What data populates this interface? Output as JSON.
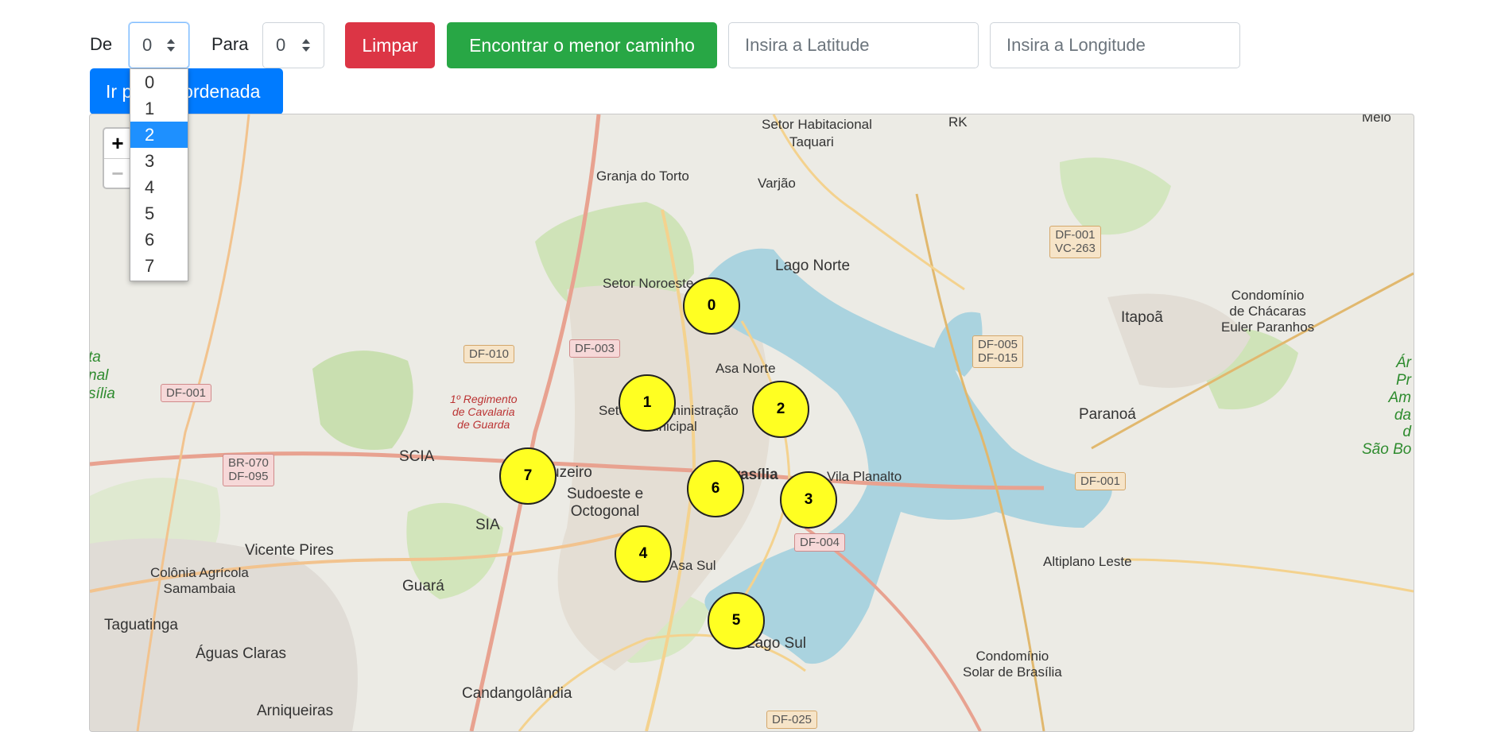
{
  "controls": {
    "from_label": "De",
    "from_value": "0",
    "to_label": "Para",
    "to_value": "0",
    "clear_button": "Limpar",
    "shortest_path_button": "Encontrar o menor caminho",
    "latitude_placeholder": "Insira a Latitude",
    "longitude_placeholder": "Insira a Longitude",
    "goto_button": "Ir para coordenada"
  },
  "dropdown": {
    "options": [
      "0",
      "1",
      "2",
      "3",
      "4",
      "5",
      "6",
      "7"
    ],
    "highlighted": "2"
  },
  "map": {
    "zoom_in": "+",
    "zoom_out": "−",
    "markers": [
      "0",
      "1",
      "2",
      "3",
      "4",
      "5",
      "6",
      "7"
    ],
    "places": {
      "setor_habitacional": "Setor Habitacional",
      "taquari": "Taquari",
      "rk": "RK",
      "melo": "Melo",
      "granja": "Granja do Torto",
      "varjao": "Varjão",
      "lago_norte": "Lago Norte",
      "setor_noroeste": "Setor Noroeste",
      "itapoa": "Itapoã",
      "condominio_chacaras": "Condomínio\nde Chácaras\nEuler Paranhos",
      "asa_norte": "Asa Norte",
      "setor_admin": "Setor de Administração\nMunicipal",
      "regimento": "1º Regimento\nde Cavalaria\nde Guarda",
      "paranoa": "Paranoá",
      "scia": "SCIA",
      "cruzeiro": "Cruzeiro",
      "brasilia": "Brasília",
      "vila_planalto": "Vila Planalto",
      "sudoeste": "Sudoeste e\nOctogonal",
      "sia": "SIA",
      "vicente_pires": "Vicente Pires",
      "asa_sul": "Asa Sul",
      "altiplano": "Altiplano Leste",
      "colonia": "Colônia Agrícola\nSamambaia",
      "guara": "Guará",
      "taguatinga": "Taguatinga",
      "lago_sul": "Lago Sul",
      "aguas_claras": "Águas Claras",
      "condominio_solar": "Condomínio\nSolar de Brasília",
      "candangolandia": "Candangolândia",
      "arniqueiras": "Arniqueiras",
      "parque_left": "ta\nnal\nsília",
      "area_right": "Ár\nPr\nAm\nda\nd\nSão Bo"
    },
    "roads": {
      "df001_vc263": "DF-001\nVC-263",
      "df005_df015": "DF-005\nDF-015",
      "df010": "DF-010",
      "df003": "DF-003",
      "df001_a": "DF-001",
      "br070": "BR-070\nDF-095",
      "df001_b": "DF-001",
      "df004": "DF-004",
      "df025": "DF-025"
    }
  }
}
